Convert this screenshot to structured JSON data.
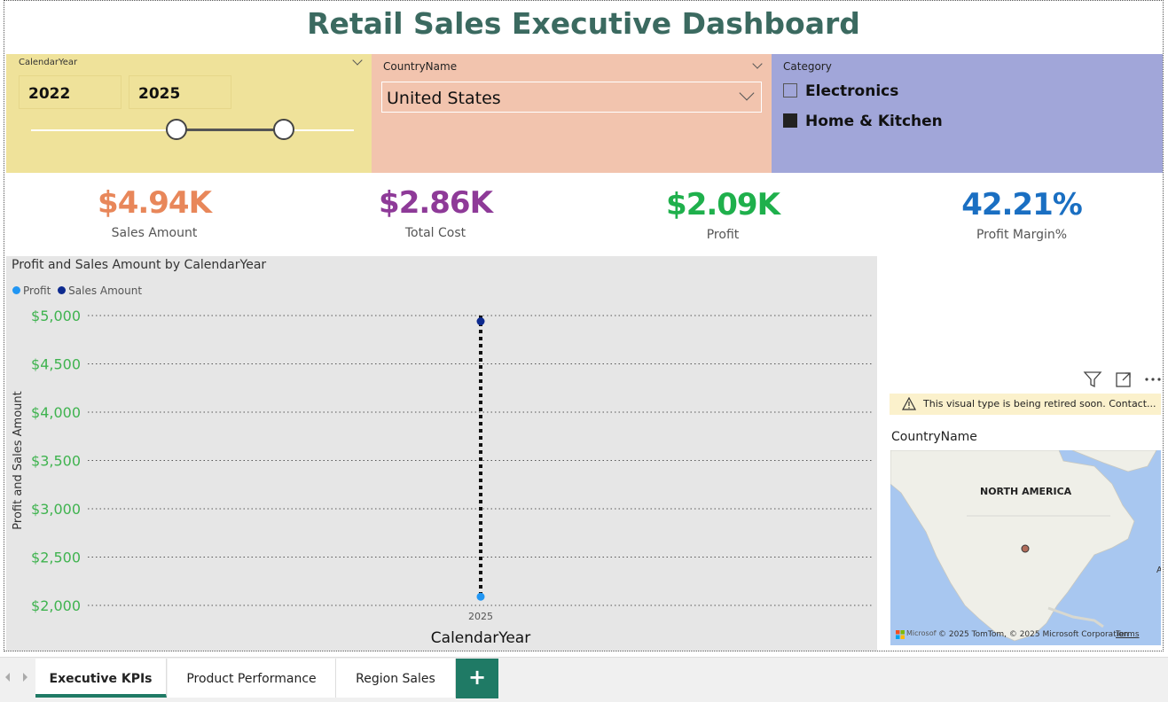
{
  "dashboard": {
    "title": "Retail Sales Executive Dashboard"
  },
  "year_slicer": {
    "header": "CalendarYear",
    "from": "2022",
    "to": "2025"
  },
  "country_slicer": {
    "header": "CountryName",
    "selected": "United States"
  },
  "category_slicer": {
    "header": "Category",
    "items": [
      {
        "label": "Electronics",
        "checked": false
      },
      {
        "label": "Home & Kitchen",
        "checked": true
      }
    ]
  },
  "kpis": [
    {
      "value": "$4.94K",
      "label": "Sales Amount",
      "color": "#e8875a"
    },
    {
      "value": "$2.86K",
      "label": "Total Cost",
      "color": "#8e3a98"
    },
    {
      "value": "$2.09K",
      "label": "Profit",
      "color": "#1fb04c"
    },
    {
      "value": "42.21%",
      "label": "Profit Margin%",
      "color": "#1a6fc2"
    }
  ],
  "chart": {
    "legend": [
      {
        "name": "Profit",
        "color": "#2196f3"
      },
      {
        "name": "Sales Amount",
        "color": "#0d2a8f"
      }
    ]
  },
  "chart_data": {
    "type": "scatter",
    "title": "Profit and Sales Amount by CalendarYear",
    "xlabel": "CalendarYear",
    "ylabel": "Profit and Sales Amount",
    "categories": [
      "2025"
    ],
    "series": [
      {
        "name": "Profit",
        "values": [
          2090
        ]
      },
      {
        "name": "Sales Amount",
        "values": [
          4940
        ]
      }
    ],
    "ylim": [
      2000,
      5000
    ],
    "yticks": [
      "$2,000",
      "$2,500",
      "$3,000",
      "$3,500",
      "$4,000",
      "$4,500",
      "$5,000"
    ],
    "grid": true,
    "legend_position": "top-left"
  },
  "map": {
    "warning": "This visual type is being retired soon. Contact...",
    "field_label": "CountryName",
    "region_label": "NORTH AMERICA",
    "attribution": "© 2025 TomTom, © 2025 Microsoft Corporation",
    "terms": "Terms",
    "ms_logo": "Microsoft Bing"
  },
  "tabs": [
    {
      "label": "Executive KPIs",
      "active": true
    },
    {
      "label": "Product Performance",
      "active": false
    },
    {
      "label": "Region Sales",
      "active": false
    }
  ],
  "add_tab_label": "+"
}
